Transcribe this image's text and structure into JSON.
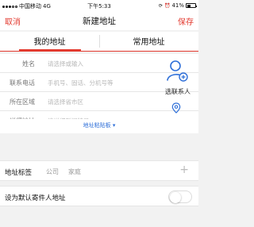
{
  "status_bar": {
    "carrier": "中国移动",
    "network": "4G",
    "time": "下午5:33",
    "battery_text": "41%",
    "battery_level": 0.41
  },
  "nav": {
    "cancel": "取消",
    "title": "新建地址",
    "save": "保存"
  },
  "tabs": [
    {
      "label": "我的地址",
      "active": true
    },
    {
      "label": "常用地址",
      "active": false
    }
  ],
  "form": {
    "fields": [
      {
        "label": "姓名",
        "placeholder": "请选择或输入"
      },
      {
        "label": "联系电话",
        "placeholder": "手机号、固话、分机号等"
      },
      {
        "label": "所在区域",
        "placeholder": "请选择省市区"
      },
      {
        "label": "详细地址",
        "placeholder": "请详细到门牌号"
      }
    ],
    "contact_button": "选联系人",
    "paste_link": "地址粘贴板"
  },
  "tags": {
    "label": "地址标签",
    "options": [
      "公司",
      "家庭"
    ]
  },
  "default_address": {
    "label": "设为默认寄件人地址",
    "enabled": false
  },
  "colors": {
    "accent": "#e33a2f",
    "link": "#2e6fd8",
    "icon_blue": "#2e6fd8"
  }
}
